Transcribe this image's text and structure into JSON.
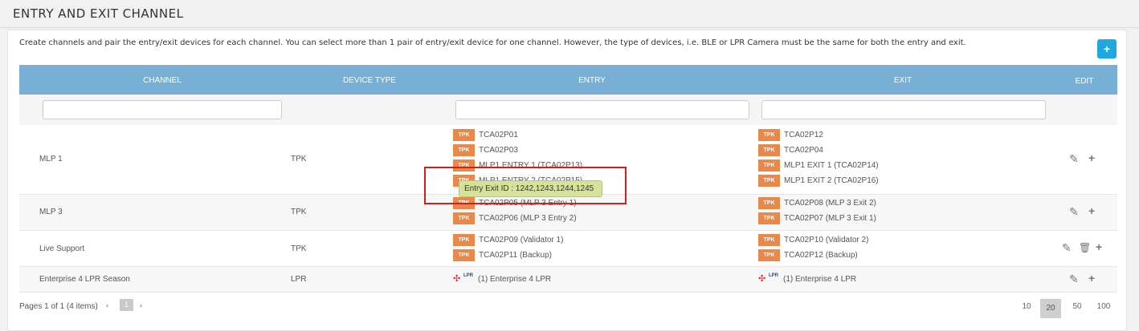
{
  "page": {
    "title": "ENTRY AND EXIT CHANNEL"
  },
  "panel": {
    "description": "Create channels and pair the entry/exit devices for each channel. You can select more than 1 pair of entry/exit device for one channel. However, the type of devices, i.e. BLE or LPR Camera must be the same for both the entry and exit.",
    "add_label": "+"
  },
  "table": {
    "headers": {
      "channel": "CHANNEL",
      "device_type": "DEVICE TYPE",
      "entry": "ENTRY",
      "exit": "EXIT",
      "edit": "EDIT"
    },
    "filters": {
      "channel": "",
      "entry": "",
      "exit": ""
    },
    "rows": [
      {
        "channel": "MLP 1",
        "device_type": "TPK",
        "entry": [
          {
            "badge": "TPK",
            "label": "TCA02P01"
          },
          {
            "badge": "TPK",
            "label": "TCA02P03"
          },
          {
            "badge": "TPK",
            "label": "MLP1 ENTRY 1 (TCA02P13)"
          },
          {
            "badge": "TPK",
            "label": "MLP1 ENTRY 2 (TCA02P15)"
          }
        ],
        "exit": [
          {
            "badge": "TPK",
            "label": "TCA02P12"
          },
          {
            "badge": "TPK",
            "label": "TCA02P04"
          },
          {
            "badge": "TPK",
            "label": "MLP1 EXIT 1 (TCA02P14)"
          },
          {
            "badge": "TPK",
            "label": "MLP1 EXIT 2 (TCA02P16)"
          }
        ]
      },
      {
        "channel": "MLP 3",
        "device_type": "TPK",
        "entry": [
          {
            "badge": "TPK",
            "label": "TCA02P05 (MLP 3 Entry 1)"
          },
          {
            "badge": "TPK",
            "label": "TCA02P06 (MLP 3 Entry 2)"
          }
        ],
        "exit": [
          {
            "badge": "TPK",
            "label": "TCA02P08 (MLP 3 Exit 2)"
          },
          {
            "badge": "TPK",
            "label": "TCA02P07 (MLP 3 Exit 1)"
          }
        ]
      },
      {
        "channel": "Live Support",
        "device_type": "TPK",
        "entry": [
          {
            "badge": "TPK",
            "label": "TCA02P09 (Validator 1)"
          },
          {
            "badge": "TPK",
            "label": "TCA02P11 (Backup)"
          }
        ],
        "exit": [
          {
            "badge": "TPK",
            "label": "TCA02P10 (Validator 2)"
          },
          {
            "badge": "TPK",
            "label": "TCA02P12 (Backup)"
          }
        ]
      },
      {
        "channel": "Enterprise 4 LPR Season",
        "device_type": "LPR",
        "entry": [
          {
            "badge": "LPR",
            "label": "(1) Enterprise 4 LPR"
          }
        ],
        "exit": [
          {
            "badge": "LPR",
            "label": "(1) Enterprise 4 LPR"
          }
        ]
      }
    ]
  },
  "tooltip": {
    "text": "Entry Exit ID : 1242,1243,1244,1245"
  },
  "pager": {
    "info": "Pages 1 of 1 (4 items)",
    "prev": "‹",
    "next": "›",
    "current_page": "1",
    "sizes": [
      "10",
      "20",
      "50",
      "100"
    ],
    "active_size": "20"
  },
  "icons": {
    "edit": "pencil-icon",
    "add": "plus-icon",
    "delete": "trash-icon"
  },
  "colors": {
    "header_bg": "#78afd5",
    "tpk_badge": "#e8884a",
    "add_button": "#1ea7e0",
    "tooltip_bg": "#d5e39a",
    "highlight_box": "#d41f1f"
  }
}
